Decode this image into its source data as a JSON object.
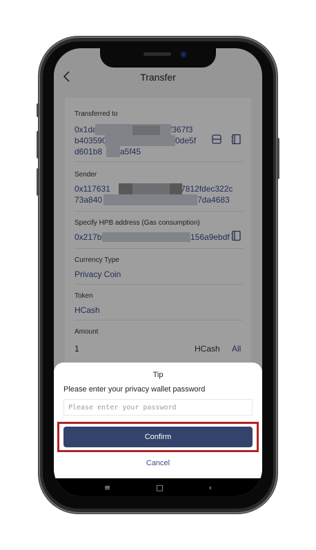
{
  "header": {
    "title": "Transfer"
  },
  "form": {
    "transferred_to": {
      "label": "Transferred to",
      "line1": "0x1da",
      "line1_tail": "f367f3",
      "line2": "b403590",
      "line2_tail": "0de5f",
      "line3": "d601b8",
      "line3_tail": "a5f45"
    },
    "sender": {
      "label": "Sender",
      "line1": "0x117631",
      "line1_tail": "7812fdec322c",
      "line2": "73a840",
      "line2_tail": "7da4683"
    },
    "gas_address": {
      "label": "Specify HPB address (Gas consumption)",
      "value_start": "0x217b",
      "value_tail": "156a9ebdf"
    },
    "currency_type": {
      "label": "Currency Type",
      "value": "Privacy Coin"
    },
    "token": {
      "label": "Token",
      "value": "HCash"
    },
    "amount": {
      "label": "Amount",
      "value": "1",
      "unit": "HCash",
      "all_label": "All"
    }
  },
  "dialog": {
    "title": "Tip",
    "prompt": "Please enter your privacy wallet password",
    "password_placeholder": "Please enter your password",
    "confirm_label": "Confirm",
    "cancel_label": "Cancel"
  },
  "system_nav": {
    "menu": "≡",
    "home": "□",
    "back": "‹"
  },
  "colors": {
    "accent": "#34436b",
    "link": "#3b4a8a",
    "highlight": "#b22222"
  }
}
